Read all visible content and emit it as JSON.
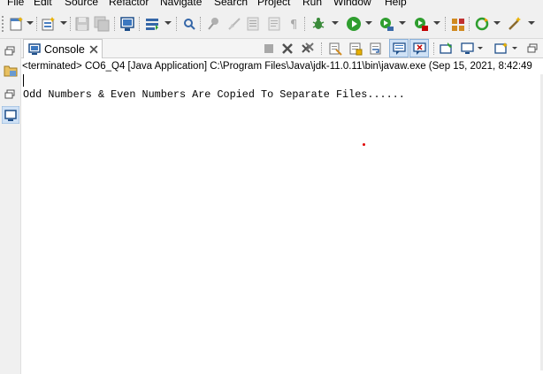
{
  "menu": {
    "items": [
      "File",
      "Edit",
      "Source",
      "Refactor",
      "Navigate",
      "Search",
      "Project",
      "Run",
      "Window",
      "Help"
    ]
  },
  "toolbar": {
    "icons": [
      "new-icon",
      "new-type-icon",
      "save-icon",
      "save-all-icon",
      "terminal-icon",
      "open-task-icon",
      "search-icon",
      "pin-icon",
      "annotation-icon",
      "format-icon",
      "pilcrow-icon",
      "debug-icon",
      "run-icon",
      "coverage-icon",
      "external-tools-icon",
      "open-type-icon",
      "refresh-icon",
      "wand-icon"
    ]
  },
  "console": {
    "tab_label": "Console",
    "description": "<terminated> CO6_Q4 [Java Application] C:\\Program Files\\Java\\jdk-11.0.11\\bin\\javaw.exe  (Sep 15, 2021, 8:42:49",
    "output_line": "Odd Numbers & Even Numbers Are Copied To Separate Files......"
  },
  "colors": {
    "toolbar_bg": "#f0f0f0",
    "run_green": "#2f9e2f",
    "terminate_red": "#c00000",
    "accent_blue": "#1e6bb8"
  }
}
